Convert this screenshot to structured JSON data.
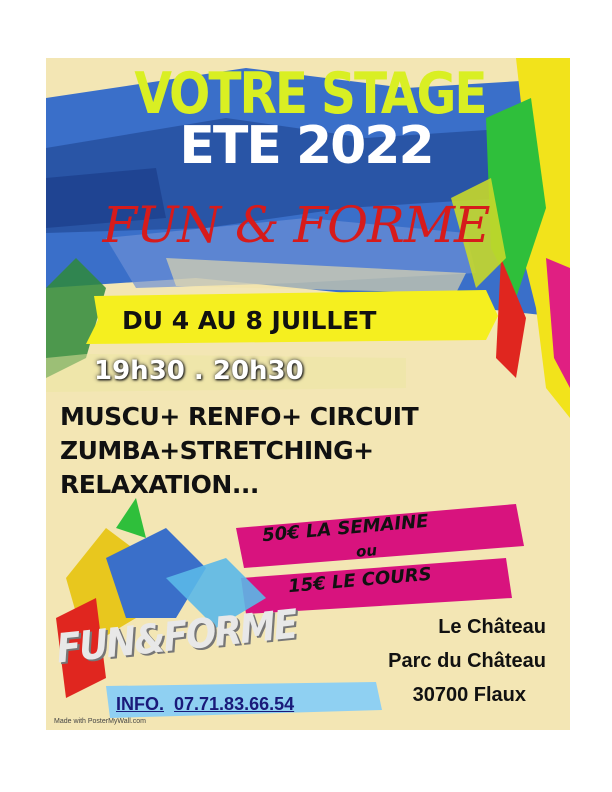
{
  "poster": {
    "title_line1": "VOTRE STAGE",
    "title_line2": "ETE 2022",
    "title_line3": "FUN & FORME",
    "dates": "DU 4 AU 8 JUILLET",
    "hours": "19h30 . 20h30",
    "activities": [
      "MUSCU+ RENFO+ CIRCUIT",
      "ZUMBA+STRETCHING+",
      "RELAXATION..."
    ],
    "price_week": "50€ LA SEMAINE",
    "price_or": "ou",
    "price_course": "15€ LE COURS",
    "logo_text": "FUN&FORME",
    "address": [
      "Le Château",
      "Parc du Château",
      "30700 Flaux"
    ],
    "info_label": "INFO.",
    "info_phone": "07.71.83.66.54",
    "made_with": "Made with PosterMyWall.com"
  },
  "colors": {
    "background": "#f3e6b4",
    "title_lime": "#d9ef23",
    "title_red": "#d61b1b",
    "yellow_band": "#f5ef1f",
    "magenta_band": "#d8137e",
    "blue_paint": "#2f63c2",
    "info_band": "#8fd0f2"
  }
}
